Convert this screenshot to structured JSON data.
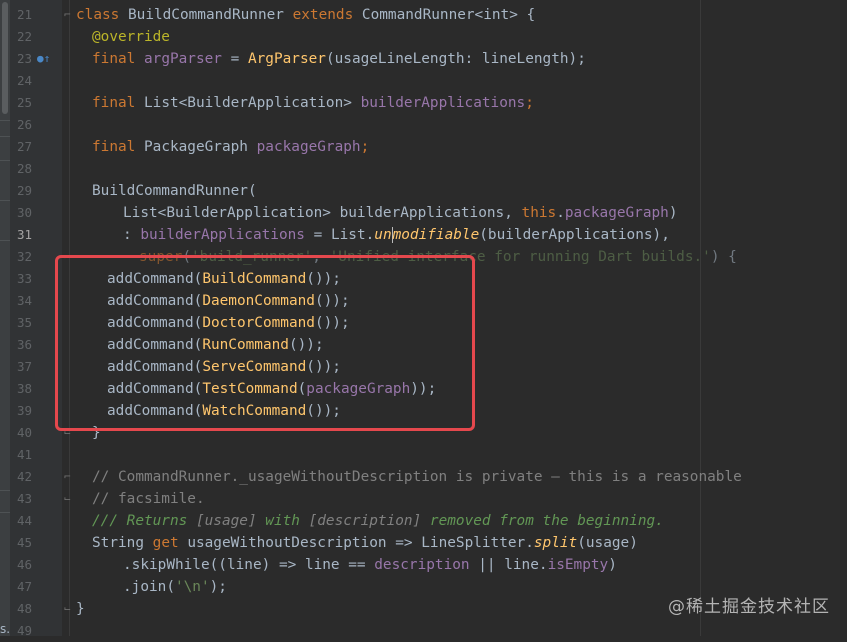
{
  "editor": {
    "line_numbers": [
      "21",
      "22",
      "23",
      "24",
      "25",
      "26",
      "27",
      "28",
      "29",
      "30",
      "31",
      "32",
      "33",
      "34",
      "35",
      "36",
      "37",
      "38",
      "39",
      "40",
      "41",
      "42",
      "43",
      "44",
      "45",
      "46",
      "47",
      "48",
      "49"
    ],
    "current_line": "31",
    "side_label": "s.",
    "code": {
      "class_kw": "class",
      "class_name": " BuildCommandRunner ",
      "extends_kw": "extends",
      "base_class": " CommandRunner<int> {",
      "override": "@override",
      "final_kw": "final",
      "argparser_name": " argParser",
      "eq": " = ",
      "argparser_ctor": "ArgParser",
      "argparser_args": "(usageLineLength: lineLength);",
      "list_type": " List<BuilderApplication> ",
      "builder_apps_field": "builderApplications",
      "semi": ";",
      "pkg_graph_type": " PackageGraph ",
      "pkg_graph_field": "packageGraph",
      "ctor_name": "BuildCommandRunner(",
      "ctor_param_type": "List<BuilderApplication> builderApplications, ",
      "this_kw": "this",
      "dot": ".",
      "ctor_param_close": ")",
      "init_colon": ": ",
      "list_cls": "List",
      "unmodifiable_a": "un",
      "unmodifiable_b": "modifiable",
      "unmodifiable_args": "(builderApplications),",
      "super_kw": "super",
      "super_str1": "'build_runner'",
      "super_comma": ", ",
      "super_str2": "'Unified interface for running Dart builds.'",
      "super_close": ") {",
      "add_command": "addCommand(",
      "cmd_build": "BuildCommand",
      "cmd_daemon": "DaemonCommand",
      "cmd_doctor": "DoctorCommand",
      "cmd_run": "RunCommand",
      "cmd_serve": "ServeCommand",
      "cmd_test": "TestCommand",
      "cmd_watch": "WatchCommand",
      "call_close": "());",
      "open_paren": "(",
      "test_arg": "packageGraph",
      "test_close": "));",
      "close_brace": "}",
      "comment1": "// CommandRunner._usageWithoutDescription is private – this is a reasonable",
      "comment2": "// facsimile.",
      "doc_prefix": "/// Returns ",
      "doc_usage": "[usage]",
      "doc_with": " with ",
      "doc_desc": "[description]",
      "doc_suffix": " removed from the beginning.",
      "string_type": "String ",
      "get_kw": "get",
      "getter_name": " usageWithoutDescription => LineSplitter.",
      "split_fn": "split",
      "split_args": "(usage)",
      "skip_while": ".skipWhile((line) => line == ",
      "description_field": "description",
      "or_op": " || line.",
      "is_empty": "isEmpty",
      "skip_close": ")",
      "join_open": ".join(",
      "join_arg": "'\\n'",
      "join_close": ");"
    }
  },
  "watermark": "@稀土掘金技术社区"
}
